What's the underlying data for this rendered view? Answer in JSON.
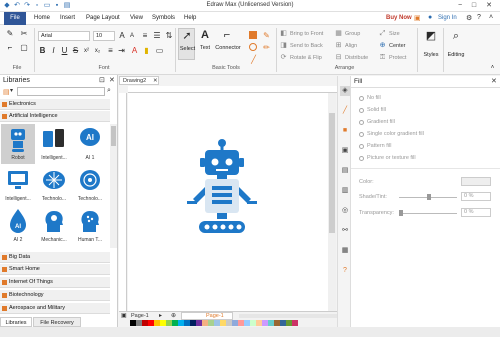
{
  "window": {
    "title": "Edraw Max (Unlicensed Version)",
    "controls": [
      "−",
      "□",
      "✕"
    ]
  },
  "menu": {
    "file": "File",
    "items": [
      "Home",
      "Insert",
      "Page Layout",
      "View",
      "Symbols",
      "Help"
    ],
    "buy_now": "Buy Now",
    "sign_in": "Sign In"
  },
  "ribbon": {
    "groups": {
      "file": "File",
      "font": "Font",
      "basic_tools": "Basic Tools",
      "arrange": "Arrange"
    },
    "font_name": "Arial",
    "font_size": "10",
    "tools": {
      "select": "Select",
      "text": "Text",
      "connector": "Connector"
    },
    "arrange": {
      "bring_front": "Bring to Front",
      "send_back": "Send to Back",
      "rotate_flip": "Rotate & Flip",
      "group": "Group",
      "align": "Align",
      "distribute": "Distribute",
      "size": "Size",
      "center": "Center",
      "protect": "Protect"
    },
    "styles": "Styles",
    "editing": "Editing"
  },
  "libraries": {
    "title": "Libraries",
    "search_placeholder": "",
    "categories_top": [
      "Electronics",
      "Artificial Intelligence"
    ],
    "shapes": [
      {
        "label": "Robot",
        "icon": "robot-icon"
      },
      {
        "label": "Intelligent...",
        "icon": "smart-devices-icon"
      },
      {
        "label": "AI 1",
        "icon": "ai-bubble-icon"
      },
      {
        "label": "Intelligent...",
        "icon": "monitor-icon"
      },
      {
        "label": "Technolo...",
        "icon": "brain-icon"
      },
      {
        "label": "Technolo...",
        "icon": "brain-circle-icon"
      },
      {
        "label": "AI 2",
        "icon": "ai-drop-icon"
      },
      {
        "label": "Mechanic...",
        "icon": "head-gear-icon"
      },
      {
        "label": "Human T...",
        "icon": "human-head-icon"
      }
    ],
    "categories_bottom": [
      "Big Data",
      "Smart Home",
      "Internet Of Things",
      "Biotechnology",
      "Aerospace and Military"
    ],
    "bottom_tabs": [
      "Libraries",
      "File Recovery"
    ]
  },
  "document": {
    "tab": "Drawing2",
    "page_tab": "Page-1",
    "active_page": "Page-1"
  },
  "fill_panel": {
    "title": "Fill",
    "options": [
      "No fill",
      "Solid fill",
      "Gradient fill",
      "Single color gradient fill",
      "Pattern fill",
      "Picture or texture fill"
    ],
    "color_label": "Color:",
    "shade_label": "Shade/Tint:",
    "shade_value": "0 %",
    "transparency_label": "Transparency:",
    "transparency_value": "0 %"
  },
  "colors": {
    "file_tab": "#2f5597",
    "robot_blue": "#1e78c8",
    "accent_orange": "#e07a2b",
    "buy_now": "#c0392b"
  }
}
